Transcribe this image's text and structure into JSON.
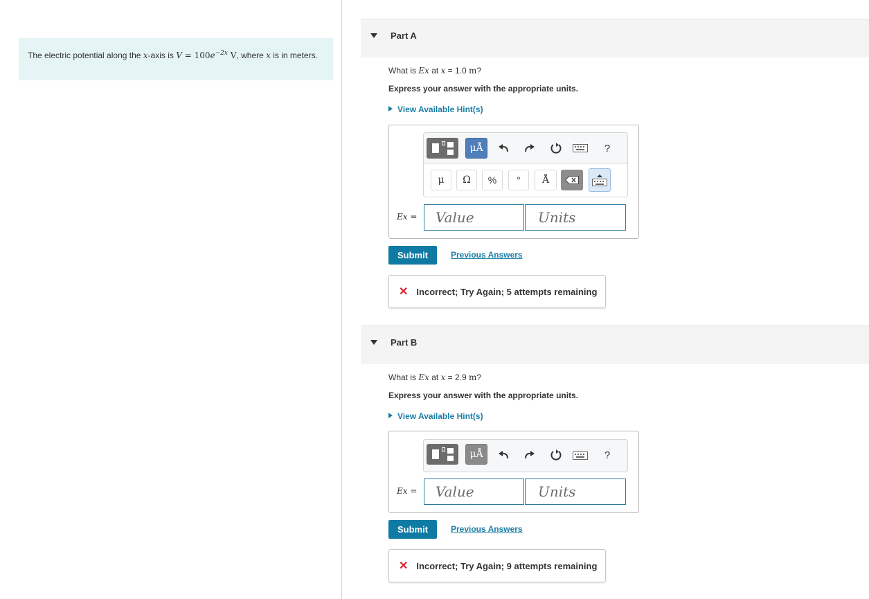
{
  "problem": {
    "prefix": "The electric potential along the ",
    "var_x": "x",
    "mid": "-axis is ",
    "eq_v": "V",
    "eq_equals": " = 100",
    "eq_e": "e",
    "exponent": "−2x",
    "unit_v": " V",
    "suffix": ", where ",
    "var_x2": "x",
    "tail": " is in meters."
  },
  "parts": [
    {
      "label": "Part A",
      "question_prefix": "What is ",
      "question_symbol": "Ex",
      "question_mid": " at ",
      "question_var": "x",
      "question_value": " = 1.0 ",
      "question_unit": "m",
      "question_end": "?",
      "instruction": "Express your answer with the appropriate units.",
      "hint": "View Available Hint(s)",
      "field_label": "Ex =",
      "value_placeholder": "Value",
      "units_placeholder": "Units",
      "submit": "Submit",
      "previous": "Previous Answers",
      "feedback": "Incorrect; Try Again; 5 attempts remaining"
    },
    {
      "label": "Part B",
      "question_prefix": "What is ",
      "question_symbol": "Ex",
      "question_mid": " at ",
      "question_var": "x",
      "question_value": " = 2.9 ",
      "question_unit": "m",
      "question_end": "?",
      "instruction": "Express your answer with the appropriate units.",
      "hint": "View Available Hint(s)",
      "field_label": "Ex =",
      "value_placeholder": "Value",
      "units_placeholder": "Units",
      "submit": "Submit",
      "previous": "Previous Answers",
      "feedback": "Incorrect; Try Again; 9 attempts remaining"
    }
  ],
  "toolbar": {
    "units_btn": "μÅ",
    "help": "?",
    "mu": "μ",
    "omega": "Ω",
    "percent": "%",
    "degree": "°",
    "angstrom": "Å"
  },
  "colors": {
    "accent": "#0f7aa3",
    "error": "#d6202e",
    "problem_bg": "#e5f4f5"
  }
}
